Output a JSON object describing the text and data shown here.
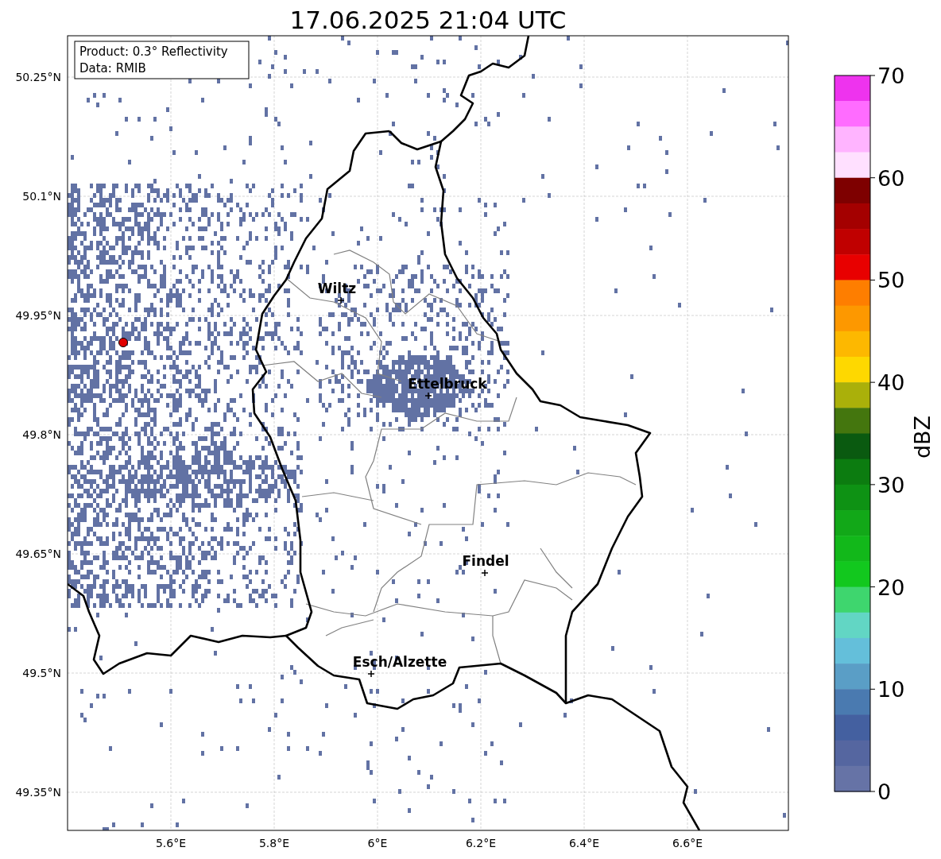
{
  "title": "17.06.2025 21:04 UTC",
  "info_box": [
    "Product: 0.3° Reflectivity",
    "Data: RMIB"
  ],
  "map": {
    "y_ticks": [
      "50.25°N",
      "50.1°N",
      "49.95°N",
      "49.8°N",
      "49.65°N",
      "49.5°N",
      "49.35°N"
    ],
    "x_ticks": [
      "5.6°E",
      "5.8°E",
      "6°E",
      "6.2°E",
      "6.4°E",
      "6.6°E"
    ],
    "cities": [
      {
        "name": "Wiltz"
      },
      {
        "name": "Ettelbruck"
      },
      {
        "name": "Findel"
      },
      {
        "name": "Esch/Alzette"
      }
    ]
  },
  "colorbar": {
    "label": "dBZ",
    "ticks": [
      "70",
      "60",
      "50",
      "40",
      "30",
      "20",
      "10",
      "0"
    ],
    "bins": [
      {
        "color": "#ee33ee"
      },
      {
        "color": "#ff6cff"
      },
      {
        "color": "#ffb4ff"
      },
      {
        "color": "#ffe0ff"
      },
      {
        "color": "#7e0000"
      },
      {
        "color": "#a40000"
      },
      {
        "color": "#c00000"
      },
      {
        "color": "#e80000"
      },
      {
        "color": "#fe7e00"
      },
      {
        "color": "#fd9800"
      },
      {
        "color": "#fdb800"
      },
      {
        "color": "#fed800"
      },
      {
        "color": "#aab00a"
      },
      {
        "color": "#44760e"
      },
      {
        "color": "#0a5a10"
      },
      {
        "color": "#0c7c10"
      },
      {
        "color": "#0e9214"
      },
      {
        "color": "#12a818"
      },
      {
        "color": "#12b81a"
      },
      {
        "color": "#12c81e"
      },
      {
        "color": "#3ed66e"
      },
      {
        "color": "#62d6c4"
      },
      {
        "color": "#64bfda"
      },
      {
        "color": "#5a9ec6"
      },
      {
        "color": "#4a7ab0"
      },
      {
        "color": "#4460a0"
      },
      {
        "color": "#5566a0"
      },
      {
        "color": "#6673a6"
      }
    ]
  }
}
